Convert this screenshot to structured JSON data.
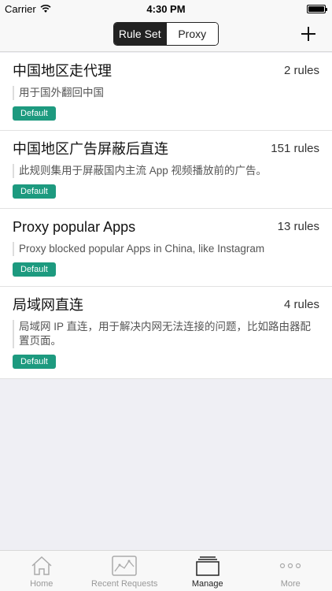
{
  "status_bar": {
    "carrier": "Carrier",
    "time": "4:30 PM"
  },
  "nav": {
    "segments": [
      {
        "label": "Rule Set",
        "active": true
      },
      {
        "label": "Proxy",
        "active": false
      }
    ],
    "add_icon": "plus-icon"
  },
  "rules": [
    {
      "title": "中国地区走代理",
      "count": "2 rules",
      "description": "用于国外翻回中国",
      "badge": "Default"
    },
    {
      "title": "中国地区广告屏蔽后直连",
      "count": "151 rules",
      "description": "此规则集用于屏蔽国内主流 App 视频播放前的广告。",
      "badge": "Default"
    },
    {
      "title": "Proxy popular Apps",
      "count": "13 rules",
      "description": "Proxy blocked popular Apps in China, like Instagram",
      "badge": "Default"
    },
    {
      "title": "局域网直连",
      "count": "4 rules",
      "description": "局域网 IP 直连，用于解决内网无法连接的问题，比如路由器配置页面。",
      "badge": "Default"
    }
  ],
  "tabs": [
    {
      "label": "Home",
      "icon": "home-icon",
      "active": false
    },
    {
      "label": "Recent Requests",
      "icon": "chart-icon",
      "active": false
    },
    {
      "label": "Manage",
      "icon": "stack-icon",
      "active": true
    },
    {
      "label": "More",
      "icon": "more-dots-icon",
      "active": false
    }
  ],
  "colors": {
    "badge": "#1d9a7f",
    "segment_active": "#222222"
  }
}
